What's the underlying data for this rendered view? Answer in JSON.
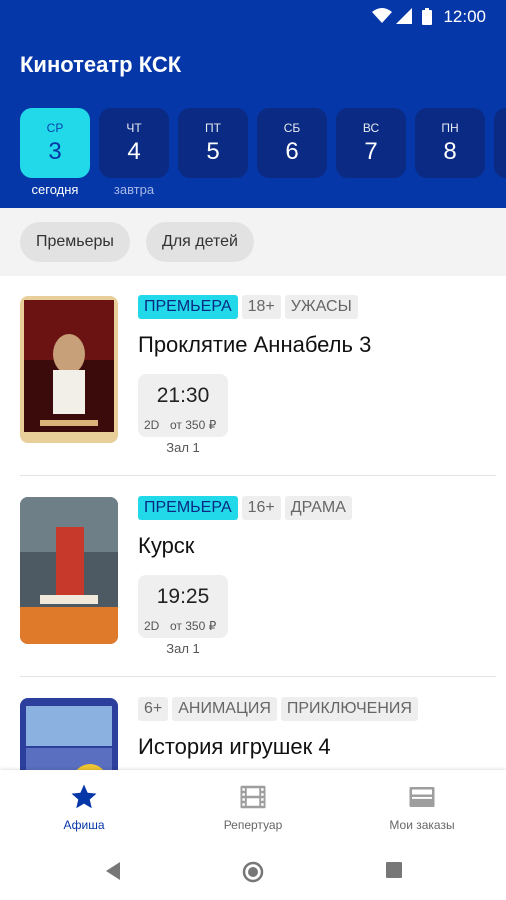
{
  "status_bar": {
    "time": "12:00"
  },
  "header": {
    "title": "Кинотеатр КСК"
  },
  "dates": [
    {
      "dow": "СР",
      "day": "3",
      "sub": "сегодня",
      "active": true
    },
    {
      "dow": "ЧТ",
      "day": "4",
      "sub": "завтра",
      "active": false
    },
    {
      "dow": "ПТ",
      "day": "5",
      "sub": "",
      "active": false
    },
    {
      "dow": "СБ",
      "day": "6",
      "sub": "",
      "active": false
    },
    {
      "dow": "ВС",
      "day": "7",
      "sub": "",
      "active": false
    },
    {
      "dow": "ПН",
      "day": "8",
      "sub": "",
      "active": false
    }
  ],
  "filters": [
    "Премьеры",
    "Для детей"
  ],
  "movies": [
    {
      "tags": [
        "ПРЕМЬЕРА",
        "18+",
        "УЖАСЫ"
      ],
      "title": "Проклятие Аннабель 3",
      "sessions": [
        {
          "time": "21:30",
          "format": "2D",
          "price": "от 350 ₽",
          "hall": "Зал 1"
        }
      ]
    },
    {
      "tags": [
        "ПРЕМЬЕРА",
        "16+",
        "ДРАМА"
      ],
      "title": "Курск",
      "sessions": [
        {
          "time": "19:25",
          "format": "2D",
          "price": "от 350 ₽",
          "hall": "Зал 1"
        }
      ]
    },
    {
      "tags": [
        "6+",
        "АНИМАЦИЯ",
        "ПРИКЛЮЧЕНИЯ"
      ],
      "title": "История игрушек 4",
      "sessions": []
    }
  ],
  "bottom_nav": [
    {
      "label": "Афиша",
      "icon": "star-icon",
      "active": true
    },
    {
      "label": "Репертуар",
      "icon": "film-icon",
      "active": false
    },
    {
      "label": "Мои заказы",
      "icon": "tickets-icon",
      "active": false
    }
  ],
  "colors": {
    "primary": "#0637a8",
    "date_inactive": "#0a2a83",
    "accent": "#21d9e8"
  }
}
